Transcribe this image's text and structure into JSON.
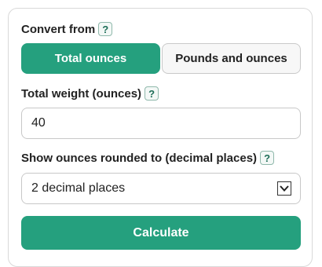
{
  "convert_from": {
    "label": "Convert from",
    "help": "?",
    "options": [
      {
        "label": "Total ounces",
        "active": true
      },
      {
        "label": "Pounds and ounces",
        "active": false
      }
    ]
  },
  "total_weight": {
    "label": "Total weight (ounces)",
    "help": "?",
    "value": "40"
  },
  "rounding": {
    "label": "Show ounces rounded to (decimal places)",
    "help": "?",
    "selected": "2 decimal places"
  },
  "calculate": {
    "label": "Calculate"
  },
  "colors": {
    "accent": "#25a07e",
    "help_border": "#8fb8ab"
  },
  "icons": {
    "help": "question-mark-icon",
    "dropdown": "chevron-down-icon"
  }
}
